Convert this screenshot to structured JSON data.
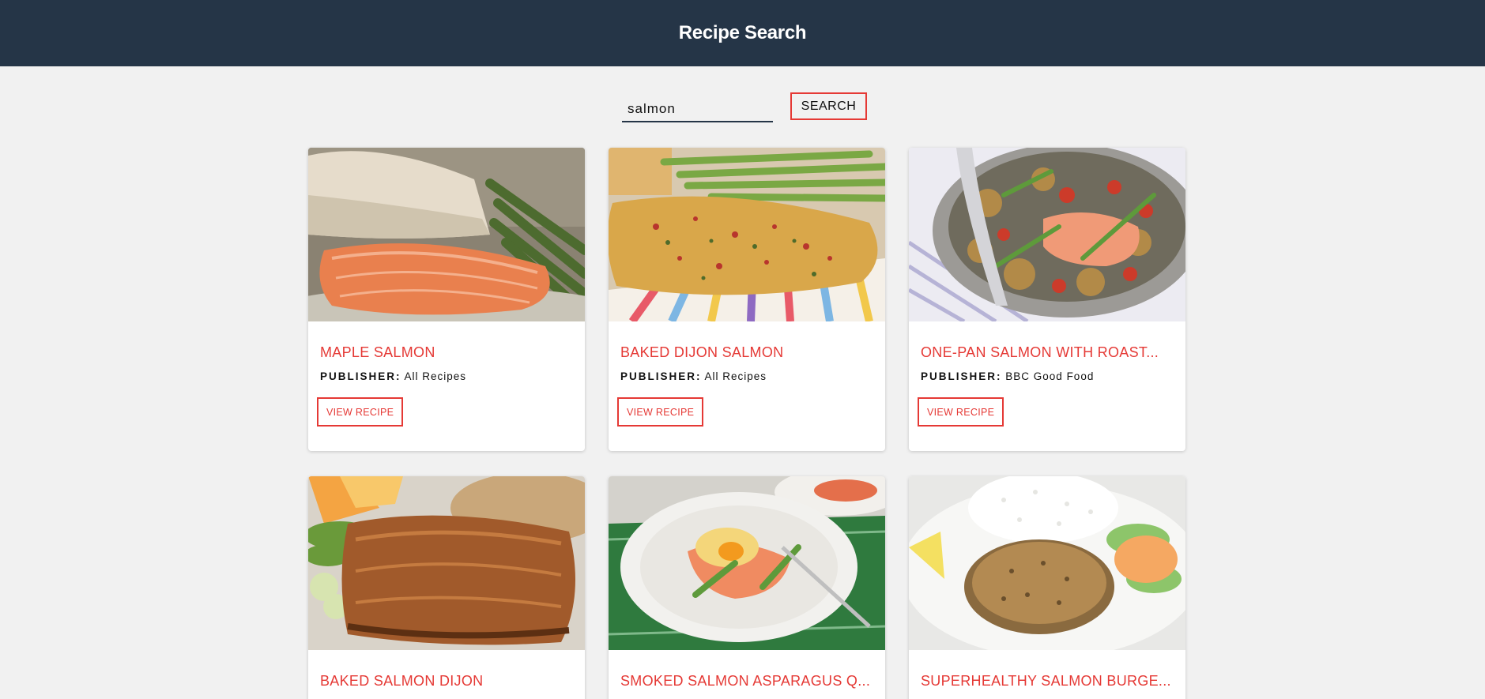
{
  "header": {
    "title": "Recipe Search"
  },
  "search": {
    "value": "salmon",
    "button_label": "SEARCH"
  },
  "publisher_label": "PUBLISHER:",
  "view_label": "VIEW RECIPE",
  "recipes": [
    {
      "title": "MAPLE SALMON",
      "publisher": "All Recipes",
      "image": "maple-salmon-photo"
    },
    {
      "title": "BAKED DIJON SALMON",
      "publisher": "All Recipes",
      "image": "baked-dijon-salmon-photo"
    },
    {
      "title": "ONE-PAN SALMON WITH ROAST...",
      "publisher": "BBC Good Food",
      "image": "one-pan-salmon-photo"
    },
    {
      "title": "BAKED SALMON DIJON",
      "image": "baked-salmon-dijon-photo"
    },
    {
      "title": "SMOKED SALMON ASPARAGUS Q...",
      "image": "smoked-salmon-asparagus-photo"
    },
    {
      "title": "SUPERHEALTHY SALMON BURGE...",
      "image": "salmon-burger-photo"
    }
  ],
  "colors": {
    "header_bg": "#253547",
    "accent": "#e53935",
    "page_bg": "#f1f1f1"
  }
}
